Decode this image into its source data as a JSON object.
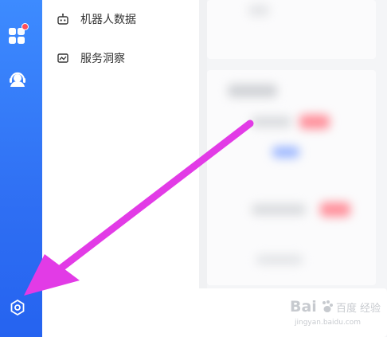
{
  "menu": {
    "items": [
      {
        "label": "机器人数据",
        "icon": "robot-icon"
      },
      {
        "label": "服务洞察",
        "icon": "insight-chart-icon"
      }
    ]
  },
  "rail": {
    "icons": [
      "apps-grid-icon",
      "customer-service-headset-icon",
      "settings-gear-icon"
    ]
  },
  "watermark": {
    "brand": "Bai",
    "brand_cn": "百度",
    "subtitle": "经验",
    "url": "jingyan.baidu.com"
  },
  "colors": {
    "rail_top": "#3d8bff",
    "rail_bottom": "#2563f0",
    "badge": "#ff4d5a",
    "annotation_arrow": "#e23be6"
  }
}
